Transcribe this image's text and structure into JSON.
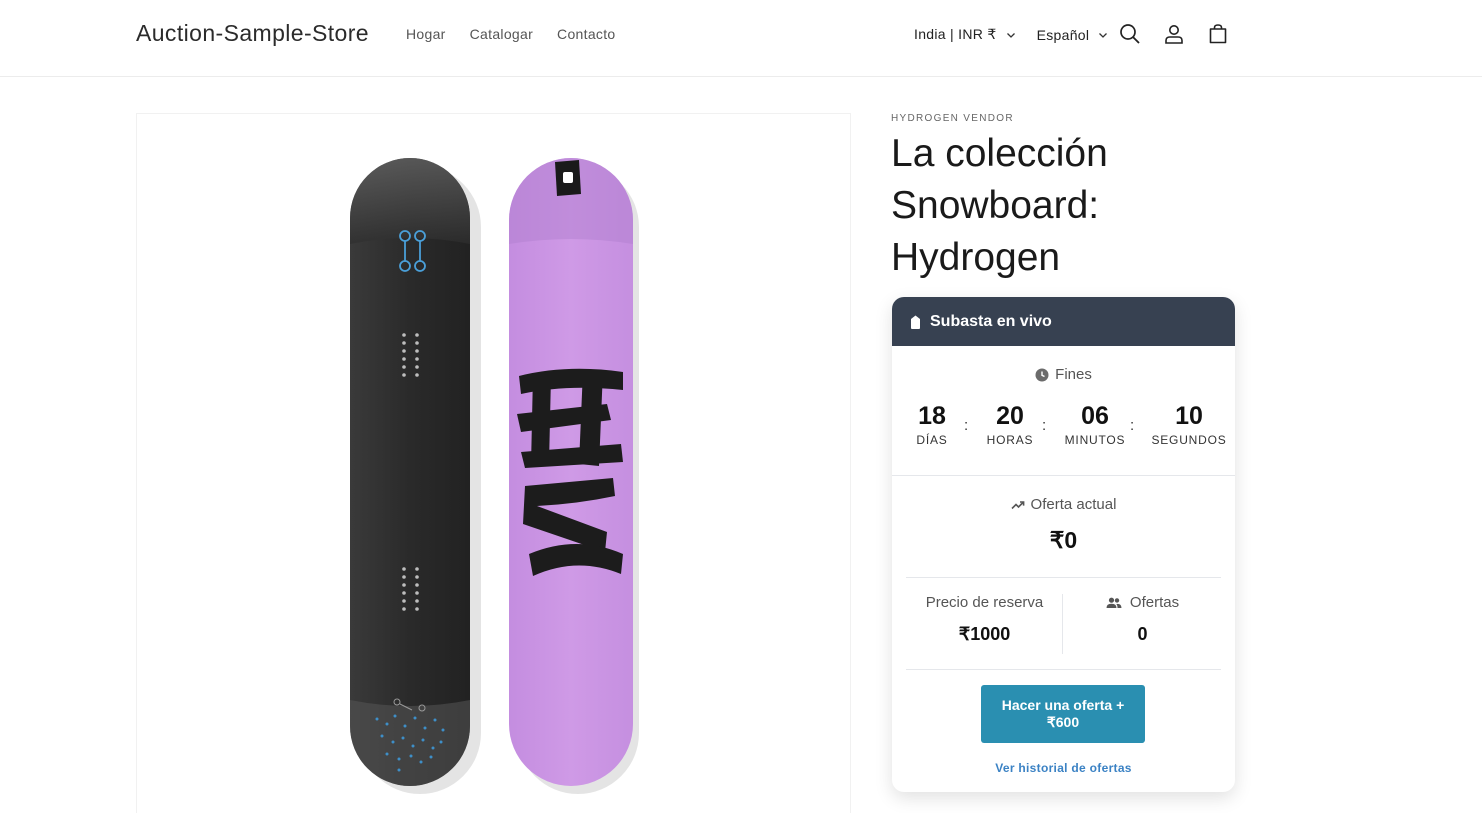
{
  "header": {
    "brand": "Auction-Sample-Store",
    "nav": [
      "Hogar",
      "Catalogar",
      "Contacto"
    ],
    "country_selector": "India | INR ₹",
    "language_selector": "Español",
    "icons": [
      "search-icon",
      "account-icon",
      "cart-icon"
    ]
  },
  "product": {
    "vendor": "HYDROGEN VENDOR",
    "title_lines": [
      "La colección",
      "Snowboard:",
      "Hydrogen"
    ]
  },
  "auction": {
    "header": "Subasta en vivo",
    "ends_label": "Fines",
    "timer": [
      {
        "value": "18",
        "label": "DÍAS"
      },
      {
        "value": "20",
        "label": "HORAS"
      },
      {
        "value": "06",
        "label": "MINUTOS"
      },
      {
        "value": "10",
        "label": "SEGUNDOS"
      }
    ],
    "current_bid_label": "Oferta actual",
    "current_bid_value": "₹0",
    "reserve_label": "Precio de reserva",
    "reserve_value": "₹1000",
    "bids_label": "Ofertas",
    "bids_value": "0",
    "bid_button_line1": "Hacer una oferta +",
    "bid_button_line2": "₹600",
    "history_link": "Ver historial de ofertas"
  },
  "colors": {
    "card_header": "#374151",
    "bid_button": "#2a8fb1",
    "link": "#3b82c4",
    "board_purple": "#cf9ae6",
    "board_black": "#2e2e2e"
  }
}
